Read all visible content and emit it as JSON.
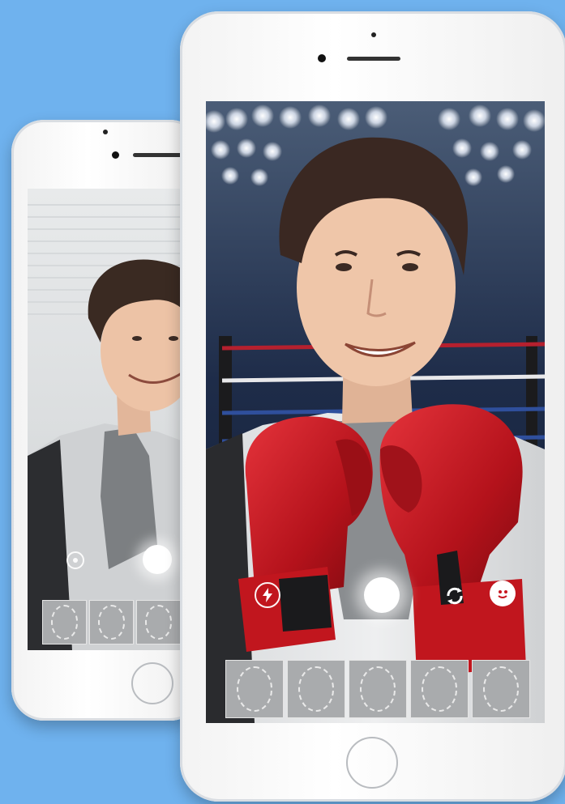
{
  "colors": {
    "background": "#6fb2ee",
    "phone_body": "#f4f4f4",
    "glove_red": "#c8161f",
    "ring_rope_red": "#b5202e",
    "ring_rope_blue": "#2f4f9c"
  },
  "scene": {
    "front_background": "boxing-ring-arena",
    "back_background": "window-blinds-room",
    "overlay_effect": "boxing-gloves"
  },
  "front_screen": {
    "controls": [
      "flash-icon",
      "shutter-button",
      "switch-camera-icon",
      "face-effects-icon"
    ],
    "thumbnails_count": 5
  },
  "back_screen": {
    "controls": [
      "settings-icon",
      "shutter-button"
    ],
    "thumbnails_count": 3
  }
}
